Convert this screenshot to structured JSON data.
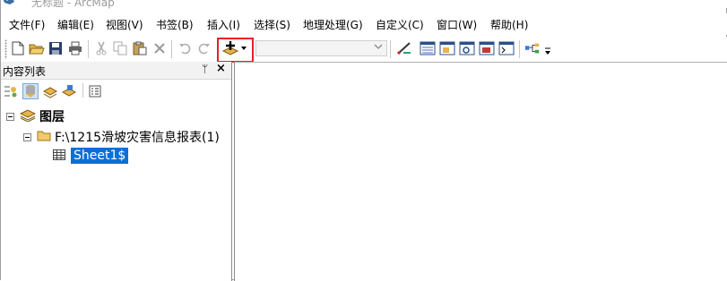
{
  "titlebar": {
    "title": "无标题 - ArcMap"
  },
  "menubar": {
    "items": [
      "文件(F)",
      "编辑(E)",
      "视图(V)",
      "书签(B)",
      "插入(I)",
      "选择(S)",
      "地理处理(G)",
      "自定义(C)",
      "窗口(W)",
      "帮助(H)"
    ]
  },
  "toolbar": {
    "icons": [
      "new-document-icon",
      "open-folder-icon",
      "save-icon",
      "print-icon",
      "cut-icon",
      "copy-icon",
      "paste-icon",
      "delete-icon",
      "undo-icon",
      "redo-icon",
      "add-data-icon",
      "dropdown-arrow-icon",
      "editor-toolbar-icon",
      "table-of-contents-icon",
      "catalog-icon",
      "search-window-icon",
      "arctoolbox-icon",
      "python-window-icon",
      "model-builder-icon"
    ],
    "scale_value": "",
    "highlight_color": "#e8202a"
  },
  "toc": {
    "title": "内容列表",
    "pin_glyph": "ᛘ",
    "close_glyph": "×",
    "tree": {
      "root_label": "图层",
      "folder_label": "F:\\1215滑坡灾害信息报表(1)",
      "table_label": "Sheet1$"
    }
  },
  "colors": {
    "selection": "#0a6fd6",
    "border": "#8c8c8c"
  }
}
